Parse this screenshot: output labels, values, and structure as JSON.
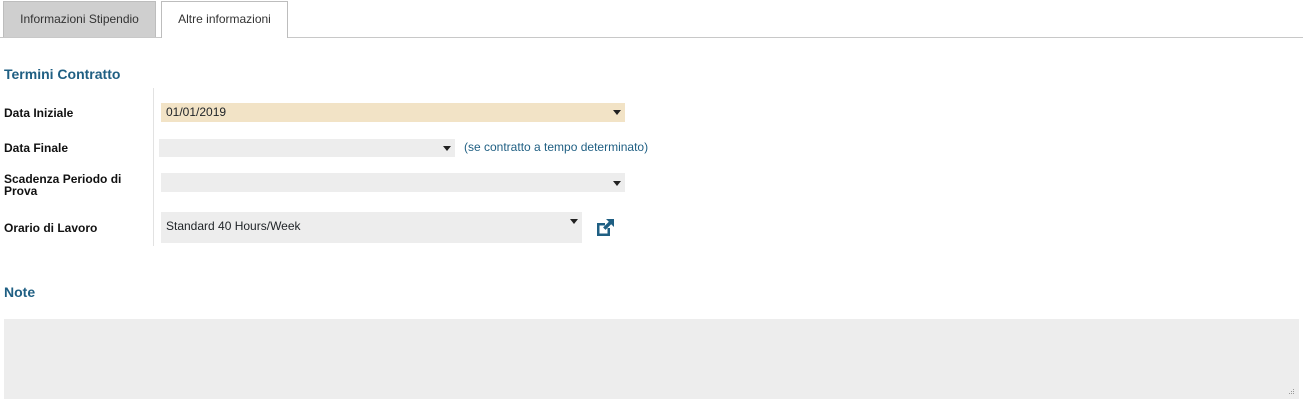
{
  "tabs": [
    {
      "label": "Informazioni Stipendio",
      "active": false
    },
    {
      "label": "Altre informazioni",
      "active": true
    }
  ],
  "termini": {
    "title": "Termini Contratto",
    "data_iniziale": {
      "label": "Data Iniziale",
      "value": "01/01/2019"
    },
    "data_finale": {
      "label": "Data Finale",
      "value": "",
      "hint": "(se contratto a tempo determinato)"
    },
    "scadenza_prova": {
      "label": "Scadenza Periodo di Prova",
      "value": ""
    },
    "orario_lavoro": {
      "label": "Orario di Lavoro",
      "value": "Standard 40 Hours/Week",
      "link_icon": "external-link-icon"
    }
  },
  "note": {
    "title": "Note",
    "value": ""
  },
  "colors": {
    "accent": "#1f5f83",
    "required_field_bg": "#f2e3c6",
    "field_bg": "#ededed",
    "inactive_tab_bg": "#cfcfcf"
  }
}
